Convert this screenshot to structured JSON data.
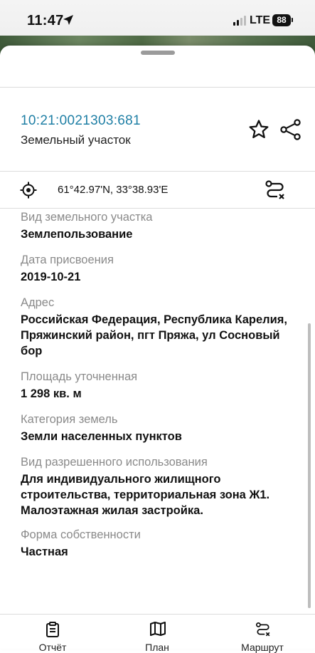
{
  "status_bar": {
    "time": "11:47",
    "network": "LTE",
    "battery": "88"
  },
  "parcel": {
    "cadastral_number": "10:21:0021303:681",
    "type": "Земельный участок",
    "coordinates": "61°42.97'N, 33°38.93'E"
  },
  "properties": [
    {
      "label": "Вид земельного участка",
      "value": "Землепользование"
    },
    {
      "label": "Дата присвоения",
      "value": "2019-10-21"
    },
    {
      "label": "Адрес",
      "value": "Российская Федерация, Республика Карелия, Пряжинский район, пгт Пряжа, ул Сосновый бор"
    },
    {
      "label": "Площадь уточненная",
      "value": "1 298 кв. м"
    },
    {
      "label": "Категория земель",
      "value": "Земли населенных пунктов"
    },
    {
      "label": "Вид разрешенного использования",
      "value": "Для индивидуального жилищного строительства, территориальная зона Ж1. Малоэтажная жилая застройка."
    },
    {
      "label": "Форма собственности",
      "value": "Частная"
    }
  ],
  "bottom_nav": [
    {
      "label": "Отчёт",
      "icon": "report-icon"
    },
    {
      "label": "План",
      "icon": "map-icon"
    },
    {
      "label": "Маршрут",
      "icon": "route-icon"
    }
  ],
  "colors": {
    "link": "#1f7fa5",
    "label": "#8a8a8a"
  }
}
